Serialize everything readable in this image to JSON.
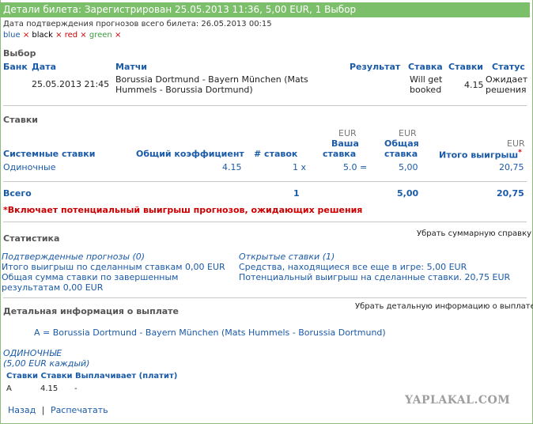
{
  "title": "Детали билета: Зарегистрирован 25.05.2013 11:36, 5,00 EUR, 1 Выбор",
  "confirm_date": "Дата подтверждения прогнозов всего билета: 26.05.2013 00:15",
  "colors_bar": {
    "blue": "blue",
    "black": "black",
    "red": "red",
    "green": "green",
    "sep": "×"
  },
  "selection": {
    "section_title": "Выбор",
    "headers": {
      "bank": "Банк",
      "date": "Дата",
      "matches": "Матчи",
      "result": "Результат",
      "stake": "Ставка",
      "stakes": "Ставки",
      "status": "Статус"
    },
    "row": {
      "date": "25.05.2013 21:45",
      "match_line1": "Borussia Dortmund - Bayern München (Mats",
      "match_line2": "Hummels - Borussia Dortmund)",
      "stake_line1": "Will get",
      "stake_line2": "booked",
      "odds": "4.15",
      "status_line1": "Ожидает",
      "status_line2": "решения"
    }
  },
  "bets": {
    "section_title": "Ставки",
    "headers": {
      "system": "Системные ставки",
      "total_coef": "Общий коэффициент",
      "num_bets": "# ставок",
      "eur1": "EUR",
      "your_stake1": "Ваша",
      "your_stake2": "ставка",
      "eur2": "EUR",
      "total_stake1": "Общая",
      "total_stake2": "ставка",
      "eur3": "EUR",
      "total_win": "Итого выигрыш",
      "asterisk": "*"
    },
    "row": {
      "type": "Одиночные",
      "coef": "4.15",
      "count": "1 x",
      "stake": "5.0 =",
      "total": "5,00",
      "win": "20,75"
    },
    "total_row": {
      "label": "Всего",
      "count": "1",
      "total": "5,00",
      "win": "20,75"
    },
    "note": "*Включает потенциальный выигрыш прогнозов, ожидающих решения"
  },
  "stats": {
    "section_title": "Статистика",
    "hide_link": "Убрать суммарную справку",
    "confirmed_title": "Подтвержденные прогнозы (0)",
    "confirmed_line1": "Итого выигрыш по сделанным ставкам 0,00 EUR",
    "confirmed_line2": "Общая сумма ставки по завершенным",
    "confirmed_line3": "результатам 0,00 EUR",
    "open_title": "Открытые ставки (1)",
    "open_line1": "Средства, находящиеся все еще в игре: 5,00 EUR",
    "open_line2": "Потенциальный выигрыш на сделанные ставки. 20,75 EUR"
  },
  "payout": {
    "section_title": "Детальная информация о выплате",
    "hide_link": "Убрать детальную информацию о выплате",
    "legend": "A = Borussia Dortmund - Bayern München (Mats Hummels - Borussia Dortmund)",
    "single_title": "ОДИНОЧНЫЕ",
    "single_sub": "(5,00 EUR каждый)",
    "table_header": "Ставки Ставки Выплачивает (платит)",
    "row": {
      "a": "A",
      "odds": "4.15",
      "pays": "-"
    }
  },
  "footer": {
    "back": "Назад",
    "sep": "|",
    "print": "Распечатать"
  },
  "watermark": "YAPLAKAL.COM"
}
